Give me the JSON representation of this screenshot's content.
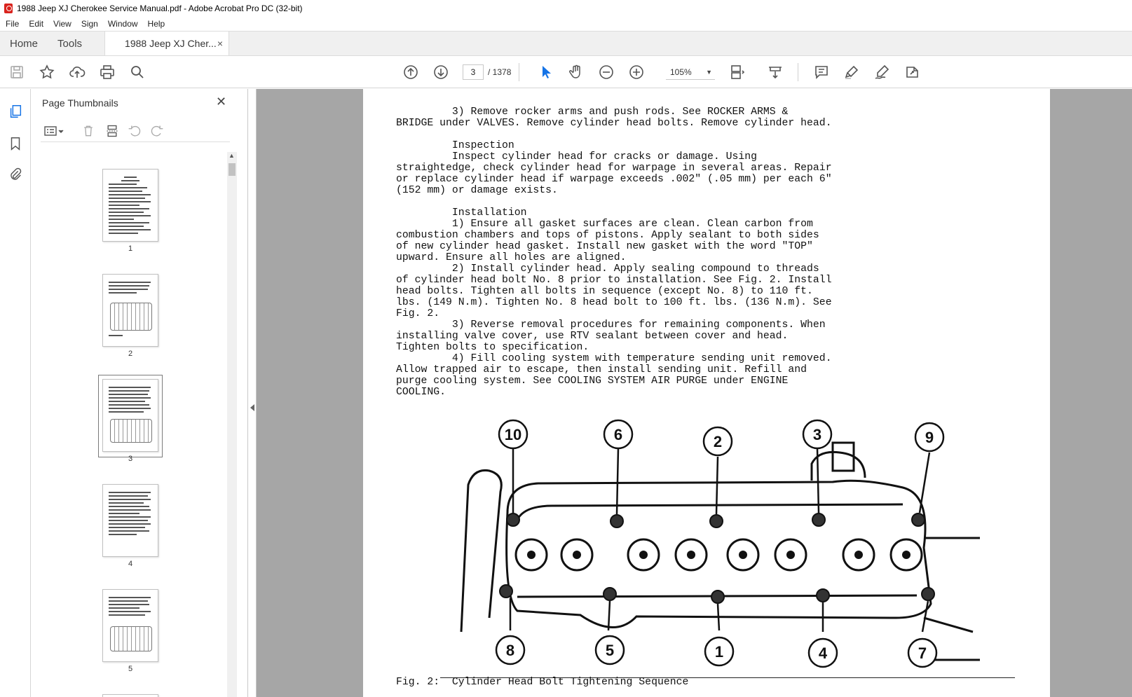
{
  "window": {
    "title": "1988 Jeep XJ Cherokee Service Manual.pdf - Adobe Acrobat Pro DC (32-bit)"
  },
  "menu": [
    "File",
    "Edit",
    "View",
    "Sign",
    "Window",
    "Help"
  ],
  "tabs": {
    "home": "Home",
    "tools": "Tools",
    "document": "1988 Jeep XJ Cher...",
    "close_glyph": "×"
  },
  "toolbar": {
    "current_page": "3",
    "page_count": "/ 1378",
    "zoom": "105%",
    "icons": [
      "save-icon",
      "star-icon",
      "upload-icon",
      "print-icon",
      "zoom-search-icon",
      "page-up-icon",
      "page-down-icon",
      "select-pointer-icon",
      "hand-icon",
      "zoom-out-icon",
      "zoom-in-icon",
      "page-display-icon",
      "scroll-mode-icon",
      "comment-icon",
      "highlight-icon",
      "sign-icon",
      "share-icon"
    ]
  },
  "sidepanel": {
    "title": "Page Thumbnails",
    "close_glyph": "✕",
    "thumbnails": [
      {
        "label": "1"
      },
      {
        "label": "2"
      },
      {
        "label": "3",
        "selected": true
      },
      {
        "label": "4"
      },
      {
        "label": "5"
      }
    ]
  },
  "document": {
    "lines": [
      "         3) Remove rocker arms and push rods. See ROCKER ARMS &",
      "BRIDGE under VALVES. Remove cylinder head bolts. Remove cylinder head.",
      "",
      "         Inspection",
      "         Inspect cylinder head for cracks or damage. Using",
      "straightedge, check cylinder head for warpage in several areas. Repair",
      "or replace cylinder head if warpage exceeds .002\" (.05 mm) per each 6\"",
      "(152 mm) or damage exists.",
      "",
      "         Installation",
      "         1) Ensure all gasket surfaces are clean. Clean carbon from",
      "combustion chambers and tops of pistons. Apply sealant to both sides",
      "of new cylinder head gasket. Install new gasket with the word \"TOP\"",
      "upward. Ensure all holes are aligned.",
      "         2) Install cylinder head. Apply sealing compound to threads",
      "of cylinder head bolt No. 8 prior to installation. See Fig. 2. Install",
      "head bolts. Tighten all bolts in sequence (except No. 8) to 110 ft.",
      "lbs. (149 N.m). Tighten No. 8 head bolt to 100 ft. lbs. (136 N.m). See",
      "Fig. 2.",
      "         3) Reverse removal procedures for remaining components. When",
      "installing valve cover, use RTV sealant between cover and head.",
      "Tighten bolts to specification.",
      "         4) Fill cooling system with temperature sending unit removed.",
      "Allow trapped air to escape, then install sending unit. Refill and",
      "purge cooling system. See COOLING SYSTEM AIR PURGE under ENGINE",
      "COOLING."
    ],
    "figure_numbers_top": [
      "10",
      "6",
      "2",
      "3",
      "9"
    ],
    "figure_numbers_bottom": [
      "8",
      "5",
      "1",
      "4",
      "7"
    ],
    "caption": "Fig. 2:  Cylinder Head Bolt Tightening Sequence"
  },
  "colors": {
    "accent_blue": "#1473e6",
    "canvas_gray": "#a6a6a6",
    "acrobat_red": "#d9231d"
  }
}
